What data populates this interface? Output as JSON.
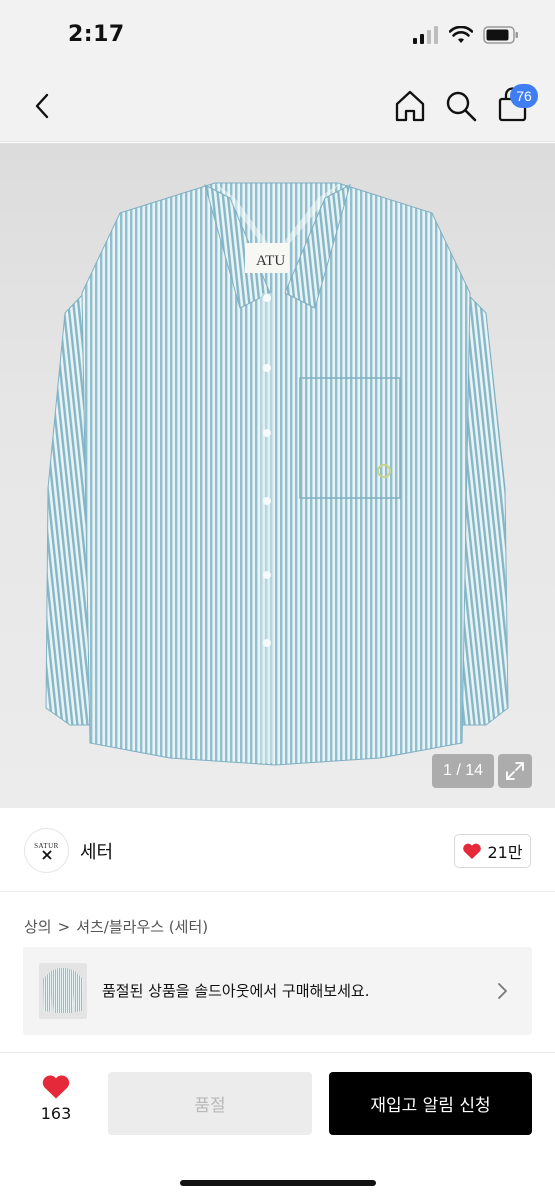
{
  "status_bar": {
    "time": "2:17"
  },
  "nav": {
    "cart_count": "76"
  },
  "gallery": {
    "counter": "1 / 14",
    "label_tag": "ATU"
  },
  "brand": {
    "logo_text": "SATUR",
    "name": "세터",
    "likes": "21만"
  },
  "breadcrumb": {
    "level1": "상의",
    "separator": ">",
    "level2": "셔츠/블라우스 (세터)"
  },
  "soldout_banner": {
    "text": "품절된 상품을 솔드아웃에서 구매해보세요."
  },
  "bottom_bar": {
    "wish_count": "163",
    "soldout_label": "품절",
    "restock_label": "재입고 알림 신청"
  },
  "colors": {
    "accent_badge": "#3f7ef2",
    "heart": "#e5283a",
    "stripe_blue": "#8fbfd0"
  },
  "icons": [
    "back-icon",
    "home-icon",
    "search-icon",
    "shopping-bag-icon",
    "expand-icon",
    "heart-icon",
    "chevron-right-icon"
  ]
}
